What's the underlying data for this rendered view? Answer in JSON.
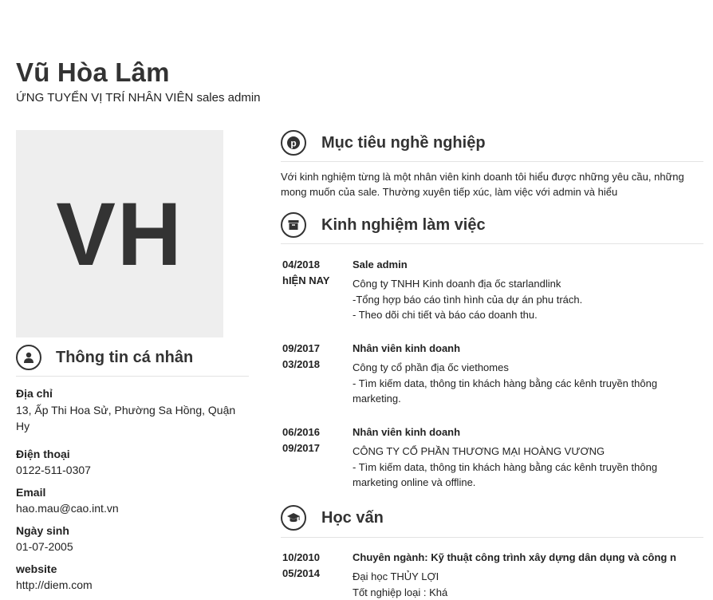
{
  "header": {
    "name": "Vũ Hòa Lâm",
    "position": "ỨNG TUYỂN VỊ TRÍ NHÂN VIÊN sales admin"
  },
  "avatar": {
    "initials": "VH"
  },
  "personal": {
    "title": "Thông tin cá nhân",
    "fields": [
      {
        "label": "Địa chỉ",
        "value": "13, Ấp Thi Hoa Sử, Phường Sa Hồng, Quận Hy"
      },
      {
        "label": "Điện thoại",
        "value": "0122-511-0307"
      },
      {
        "label": "Email",
        "value": "hao.mau@cao.int.vn"
      },
      {
        "label": "Ngày sinh",
        "value": "01-07-2005"
      },
      {
        "label": "website",
        "value": "http://diem.com"
      }
    ]
  },
  "objective": {
    "title": "Mục tiêu nghề nghiệp",
    "text": "Với kinh nghiệm từng là một nhân viên kinh doanh tôi hiểu được những yêu cầu, những mong muốn của sale. Thường xuyên tiếp xúc, làm việc với admin và hiểu"
  },
  "experience": {
    "title": "Kinh nghiệm làm việc",
    "items": [
      {
        "start": "04/2018",
        "end": "hIỆN NAY",
        "title": "Sale admin",
        "company": "Công ty TNHH Kinh doanh địa ốc starlandlink",
        "details": [
          "-Tổng hợp báo cáo tình hình của dự án phu trách.",
          "- Theo dõi chi tiết và báo cáo doanh thu."
        ]
      },
      {
        "start": "09/2017",
        "end": "03/2018",
        "title": "Nhân viên kinh doanh",
        "company": "Công ty cổ phần địa ốc viethomes",
        "details": [
          "- Tìm kiếm data, thông tin khách hàng bằng các kênh truyền thông marketing."
        ]
      },
      {
        "start": "06/2016",
        "end": "09/2017",
        "title": "Nhân viên kinh doanh",
        "company": "CÔNG TY CỔ PHẦN THƯƠNG MẠI HOÀNG VƯƠNG",
        "details": [
          "- Tìm kiếm data, thông tin khách hàng bằng các kênh truyền thông marketing online và offline."
        ]
      }
    ]
  },
  "education": {
    "title": "Học vấn",
    "items": [
      {
        "start": "10/2010",
        "end": "05/2014",
        "title": "Chuyên ngành: Kỹ thuật công trình xây dựng dân dụng và công n",
        "school": "Đại học THỦY LỢI",
        "note": "Tốt nghiệp loại : Khá"
      }
    ]
  },
  "icons": {
    "personal": "user-icon",
    "objective": "pinterest-icon",
    "experience": "archive-box-icon",
    "education": "graduation-cap-icon"
  },
  "colors": {
    "text": "#222222",
    "heading": "#333333",
    "avatar_bg": "#eeeeee",
    "divider": "#e3e3e3"
  }
}
